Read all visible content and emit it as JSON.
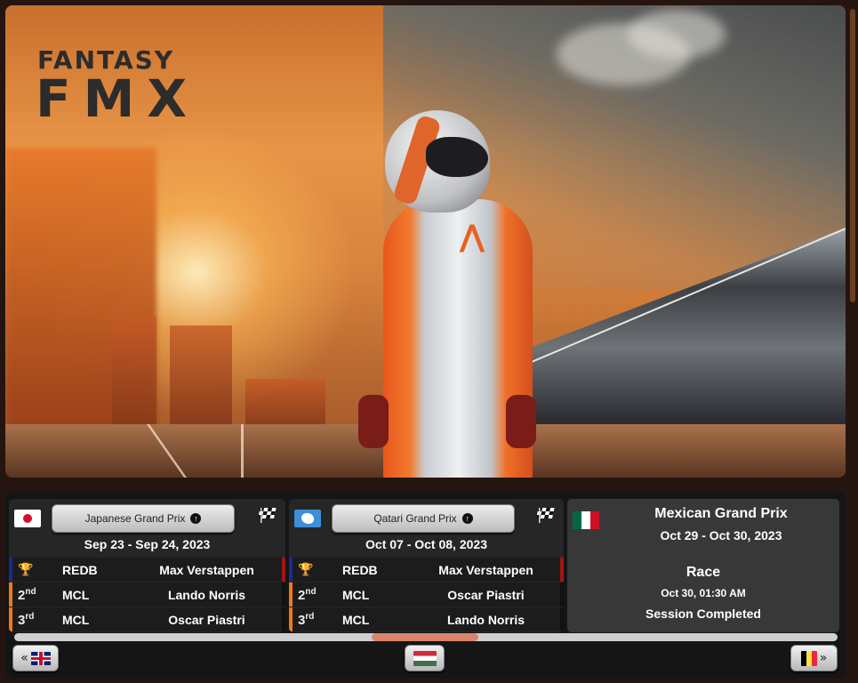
{
  "brand": {
    "logo_top": "FANTASY",
    "logo_bottom": "FMX"
  },
  "cards": [
    {
      "flag": "japan-flag",
      "grand_prix": "Japanese Grand Prix",
      "dates": "Sep 23 - Sep 24, 2023",
      "results": [
        {
          "pos_num": "",
          "pos_suffix": "",
          "trophy": true,
          "team": "REDB",
          "driver": "Max Verstappen",
          "team_color": "#1e2a8a",
          "right_color": "#a3140f"
        },
        {
          "pos_num": "2",
          "pos_suffix": "nd",
          "trophy": false,
          "team": "MCL",
          "driver": "Lando Norris",
          "team_color": "#f07a1a",
          "right_color": "#111111"
        },
        {
          "pos_num": "3",
          "pos_suffix": "rd",
          "trophy": false,
          "team": "MCL",
          "driver": "Oscar Piastri",
          "team_color": "#f07a1a",
          "right_color": "#111111"
        }
      ]
    },
    {
      "flag": "antarctica-flag",
      "grand_prix": "Qatari Grand Prix",
      "dates": "Oct 07 - Oct 08, 2023",
      "results": [
        {
          "pos_num": "",
          "pos_suffix": "",
          "trophy": true,
          "team": "REDB",
          "driver": "Max Verstappen",
          "team_color": "#1e2a8a",
          "right_color": "#a3140f"
        },
        {
          "pos_num": "2",
          "pos_suffix": "nd",
          "trophy": false,
          "team": "MCL",
          "driver": "Oscar Piastri",
          "team_color": "#f07a1a",
          "right_color": "#111111"
        },
        {
          "pos_num": "3",
          "pos_suffix": "rd",
          "trophy": false,
          "team": "MCL",
          "driver": "Lando Norris",
          "team_color": "#f07a1a",
          "right_color": "#111111"
        }
      ]
    }
  ],
  "next_event": {
    "flag": "mexico-flag",
    "title": "Mexican Grand Prix",
    "dates": "Oct 29 - Oct 30, 2023",
    "session": "Race",
    "session_time": "Oct 30, 01:30 AM",
    "status": "Session Completed"
  },
  "nav": {
    "prev_arrow": "«",
    "next_arrow": "»",
    "prev_flag": "uk-flag",
    "current_flag": "hungary-flag",
    "next_flag": "belgium-flag"
  },
  "colors": {
    "card_bg": "#262626",
    "accent_orange": "#f07a1a",
    "scroll_thumb": "#d9826c"
  }
}
